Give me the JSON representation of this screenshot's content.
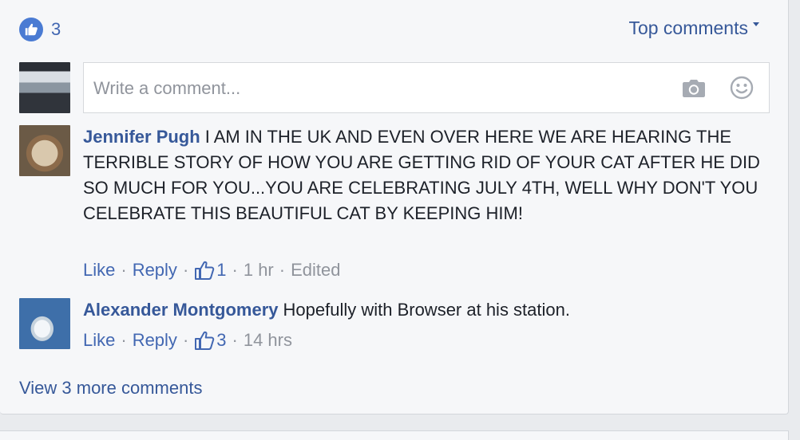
{
  "reactions": {
    "icon": "thumbs-up-icon",
    "count": "3"
  },
  "sort": {
    "label": "Top comments",
    "icon": "caret-down-icon"
  },
  "composer": {
    "placeholder": "Write a comment...",
    "camera_icon": "camera-icon",
    "emoji_icon": "smiley-icon"
  },
  "comments": [
    {
      "author": "Jennifer Pugh",
      "text": "I AM IN THE UK AND EVEN OVER HERE WE ARE HEARING THE TERRIBLE STORY OF HOW YOU ARE GETTING RID OF YOUR CAT AFTER HE DID SO MUCH FOR YOU...YOU ARE CELEBRATING JULY 4TH, WELL WHY DON'T YOU CELEBRATE THIS BEAUTIFUL CAT BY KEEPING HIM!",
      "like_label": "Like",
      "reply_label": "Reply",
      "reaction_count": "1",
      "time": "1 hr",
      "edited_label": "Edited"
    },
    {
      "author": "Alexander Montgomery",
      "text": "Hopefully with Browser at his station.",
      "like_label": "Like",
      "reply_label": "Reply",
      "reaction_count": "3",
      "time": "14 hrs"
    }
  ],
  "footer": {
    "view_more": "View 3 more comments"
  },
  "colors": {
    "link": "#365899",
    "muted": "#90949c",
    "like_badge": "#4a7bd3",
    "panel_bg": "#f6f7f9"
  }
}
